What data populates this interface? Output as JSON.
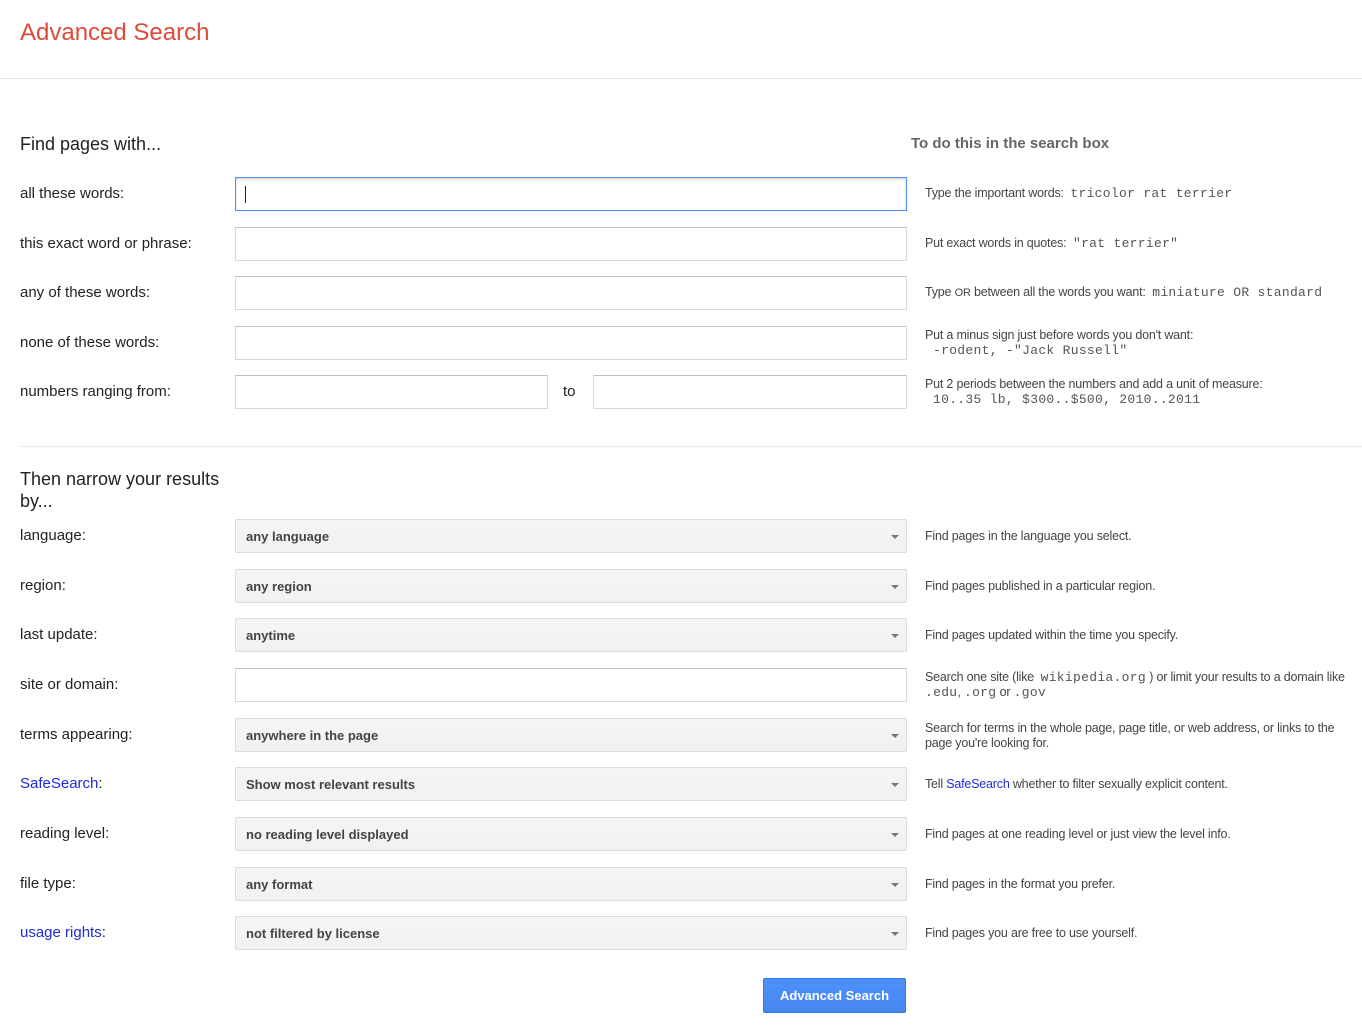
{
  "header": {
    "title": "Advanced Search"
  },
  "find_section": {
    "title": "Find pages with...",
    "column_heading": "To do this in the search box",
    "rows": [
      {
        "label": "all these words:",
        "value": "",
        "hint_text": "Type the important words:",
        "hint_example": "tricolor rat terrier"
      },
      {
        "label": "this exact word or phrase:",
        "value": "",
        "hint_text": "Put exact words in quotes:",
        "hint_example": "\"rat terrier\""
      },
      {
        "label": "any of these words:",
        "value": "",
        "hint_pre": "Type",
        "hint_or": "OR",
        "hint_post": "between all the words you want:",
        "hint_example": "miniature OR standard"
      },
      {
        "label": "none of these words:",
        "value": "",
        "hint_text": "Put a minus sign just before words you don't want:",
        "hint_example": "-rodent, -\"Jack Russell\""
      },
      {
        "label": "numbers ranging from:",
        "value_from": "",
        "to_label": "to",
        "value_to": "",
        "hint_text": "Put 2 periods between the numbers and add a unit of measure:",
        "hint_example": "10..35 lb, $300..$500, 2010..2011"
      }
    ]
  },
  "narrow_section": {
    "title": "Then narrow your results by...",
    "rows": [
      {
        "label": "language:",
        "selected": "any language",
        "hint": "Find pages in the language you select."
      },
      {
        "label": "region:",
        "selected": "any region",
        "hint": "Find pages published in a particular region."
      },
      {
        "label": "last update:",
        "selected": "anytime",
        "hint": "Find pages updated within the time you specify."
      },
      {
        "label": "site or domain:",
        "value": "",
        "hint_pre": "Search one site (like",
        "hint_ex1": "wikipedia.org",
        "hint_mid": ") or limit your results to a domain like",
        "hint_ex2": ".edu",
        "hint_comma": ",",
        "hint_ex3": ".org",
        "hint_or": "or",
        "hint_ex4": ".gov"
      },
      {
        "label": "terms appearing:",
        "selected": "anywhere in the page",
        "hint": "Search for terms in the whole page, page title, or web address, or links to the page you're looking for."
      },
      {
        "label_link": "SafeSearch",
        "label_suffix": ":",
        "selected": "Show most relevant results",
        "hint_pre": "Tell",
        "hint_link": "SafeSearch",
        "hint_post": "whether to filter sexually explicit content."
      },
      {
        "label": "reading level:",
        "selected": "no reading level displayed",
        "hint": "Find pages at one reading level or just view the level info."
      },
      {
        "label": "file type:",
        "selected": "any format",
        "hint": "Find pages in the format you prefer."
      },
      {
        "label_link": "usage rights",
        "label_suffix": ":",
        "selected": "not filtered by license",
        "hint": "Find pages you are free to use yourself."
      }
    ]
  },
  "submit": {
    "label": "Advanced Search"
  },
  "colors": {
    "title": "#dd4b39",
    "link": "#1f2ad8",
    "button": "#4d90fe",
    "focus_border": "#4d90fe"
  }
}
